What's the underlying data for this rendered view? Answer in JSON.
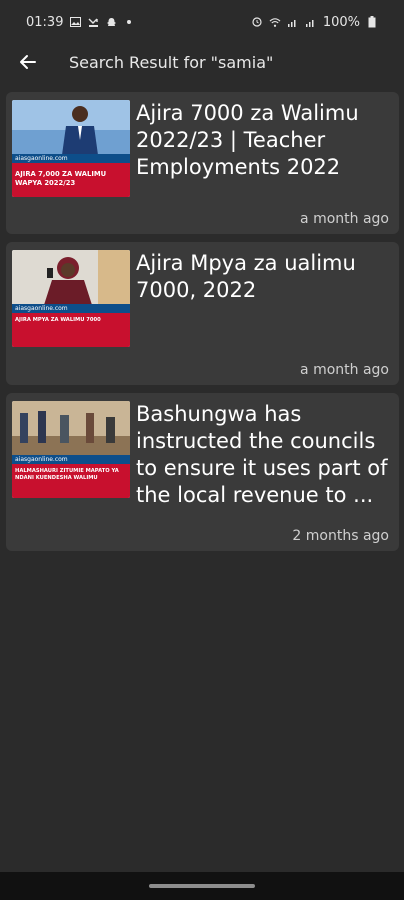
{
  "status_bar": {
    "time": "01:39",
    "battery": "100%",
    "icons_left": [
      "image-icon",
      "missed-call-icon",
      "snapchat-icon",
      "dot-icon"
    ],
    "icons_right": [
      "alarm-icon",
      "wifi-icon",
      "signal-icon",
      "signal-icon-2",
      "battery-icon"
    ]
  },
  "app_bar": {
    "title": "Search Result for \"samia\""
  },
  "results": [
    {
      "thumbnail_brand": "aiasgaonline.com",
      "thumbnail_caption": "AJIRA 7,000 ZA WALIMU WAPYA 2022/23",
      "title": "Ajira 7000 za Walimu 2022/23 | Teacher Employments 2022",
      "time": "a month ago"
    },
    {
      "thumbnail_brand": "aiasgaonline.com",
      "thumbnail_caption": "AJIRA MPYA ZA WALIMU 7000",
      "title": "Ajira Mpya za ualimu 7000, 2022",
      "time": "a month ago"
    },
    {
      "thumbnail_brand": "aiasgaonline.com",
      "thumbnail_caption": "HALMASHAURI ZITUMIE MAPATO YA NDANI KUENDESHA WALIMU",
      "title": "Bashungwa has instructed the councils to ensure it uses part of the local revenue to ...",
      "time": "2 months ago"
    }
  ],
  "colors": {
    "background": "#2b2b2b",
    "card": "#3a3a3a",
    "thumbnail_red": "#c8102e",
    "thumbnail_blue": "#0d4e8a"
  }
}
